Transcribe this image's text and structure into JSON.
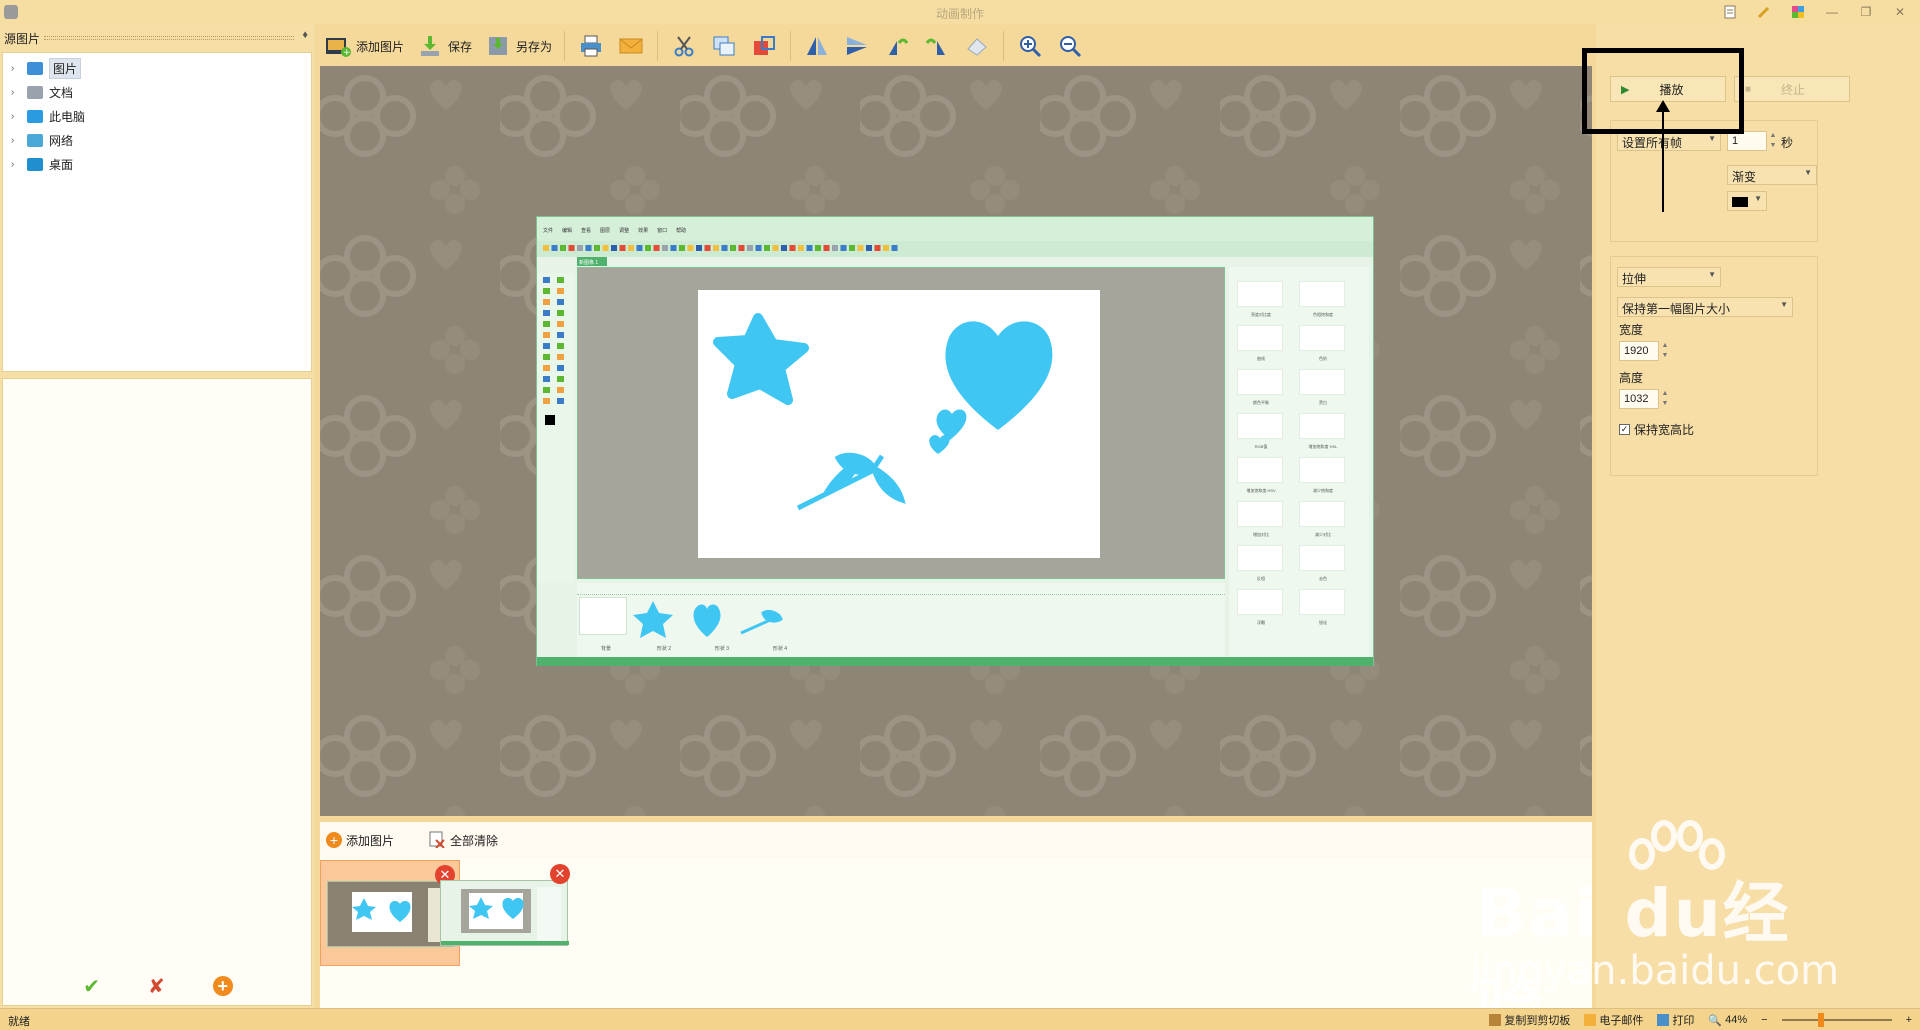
{
  "window": {
    "title": "动画制作",
    "controls": [
      "file-icon",
      "pen-icon",
      "palette-icon",
      "minimize-icon",
      "restore-icon",
      "close-icon"
    ]
  },
  "left_panel": {
    "header": "源图片",
    "pin": "♦",
    "tree": [
      {
        "label": "图片",
        "icon": "pictures-folder-icon",
        "selected": true
      },
      {
        "label": "文档",
        "icon": "documents-folder-icon",
        "selected": false
      },
      {
        "label": "此电脑",
        "icon": "computer-icon",
        "selected": false
      },
      {
        "label": "网络",
        "icon": "network-icon",
        "selected": false
      },
      {
        "label": "桌面",
        "icon": "desktop-icon",
        "selected": false
      }
    ],
    "actions": [
      {
        "icon": "check-icon",
        "glyph": "✔",
        "color": "#5bb830"
      },
      {
        "icon": "check-cross-icon",
        "glyph": "✘",
        "color": "#d24a30"
      },
      {
        "icon": "add-circle-icon",
        "glyph": "+",
        "color": "#f08a1c"
      }
    ]
  },
  "toolbar": {
    "add_image": "添加图片",
    "save": "保存",
    "save_as": "另存为"
  },
  "canvas": {
    "preview_menu": [
      "文件",
      "编辑",
      "查看",
      "图层",
      "调整",
      "效果",
      "窗口",
      "帮助"
    ],
    "preview_tab": "新图像 1",
    "right_tiles": [
      "亮度对比度",
      "色相饱和度",
      "曲线",
      "色阶",
      "颜色平衡",
      "黑白",
      "RGB值",
      "增加饱和度 HSL",
      "增加饱和度 HSV",
      "减少饱和度",
      "增加对比",
      "减少对比",
      "反相",
      "去色",
      "浮雕",
      "锐化"
    ],
    "bottom_items": [
      "背景",
      "形状 2",
      "形状 3",
      "形状 4"
    ]
  },
  "strip": {
    "add_image": "添加图片",
    "clear_all": "全部清除",
    "delete_glyph": "✕"
  },
  "right_panel": {
    "play": "播放",
    "stop": "终止",
    "set_all_frames": "设置所有帧",
    "frame_seconds": "1",
    "seconds_unit": "秒",
    "transition": "渐变",
    "color_value": "#000000",
    "stretch": "拉伸",
    "keep_first_size": "保持第一幅图片大小",
    "width_label": "宽度",
    "width_value": "1920",
    "height_label": "高度",
    "height_value": "1032",
    "keep_ratio": "保持宽高比",
    "keep_ratio_checked": true
  },
  "watermark": {
    "brand": "Bai du经验",
    "url": "jingyan.baidu.com"
  },
  "statusbar": {
    "status": "就绪",
    "copy_clipboard": "复制到剪切板",
    "email": "电子邮件",
    "print": "打印",
    "zoom": "44%",
    "zoom_fraction": 0.44
  }
}
